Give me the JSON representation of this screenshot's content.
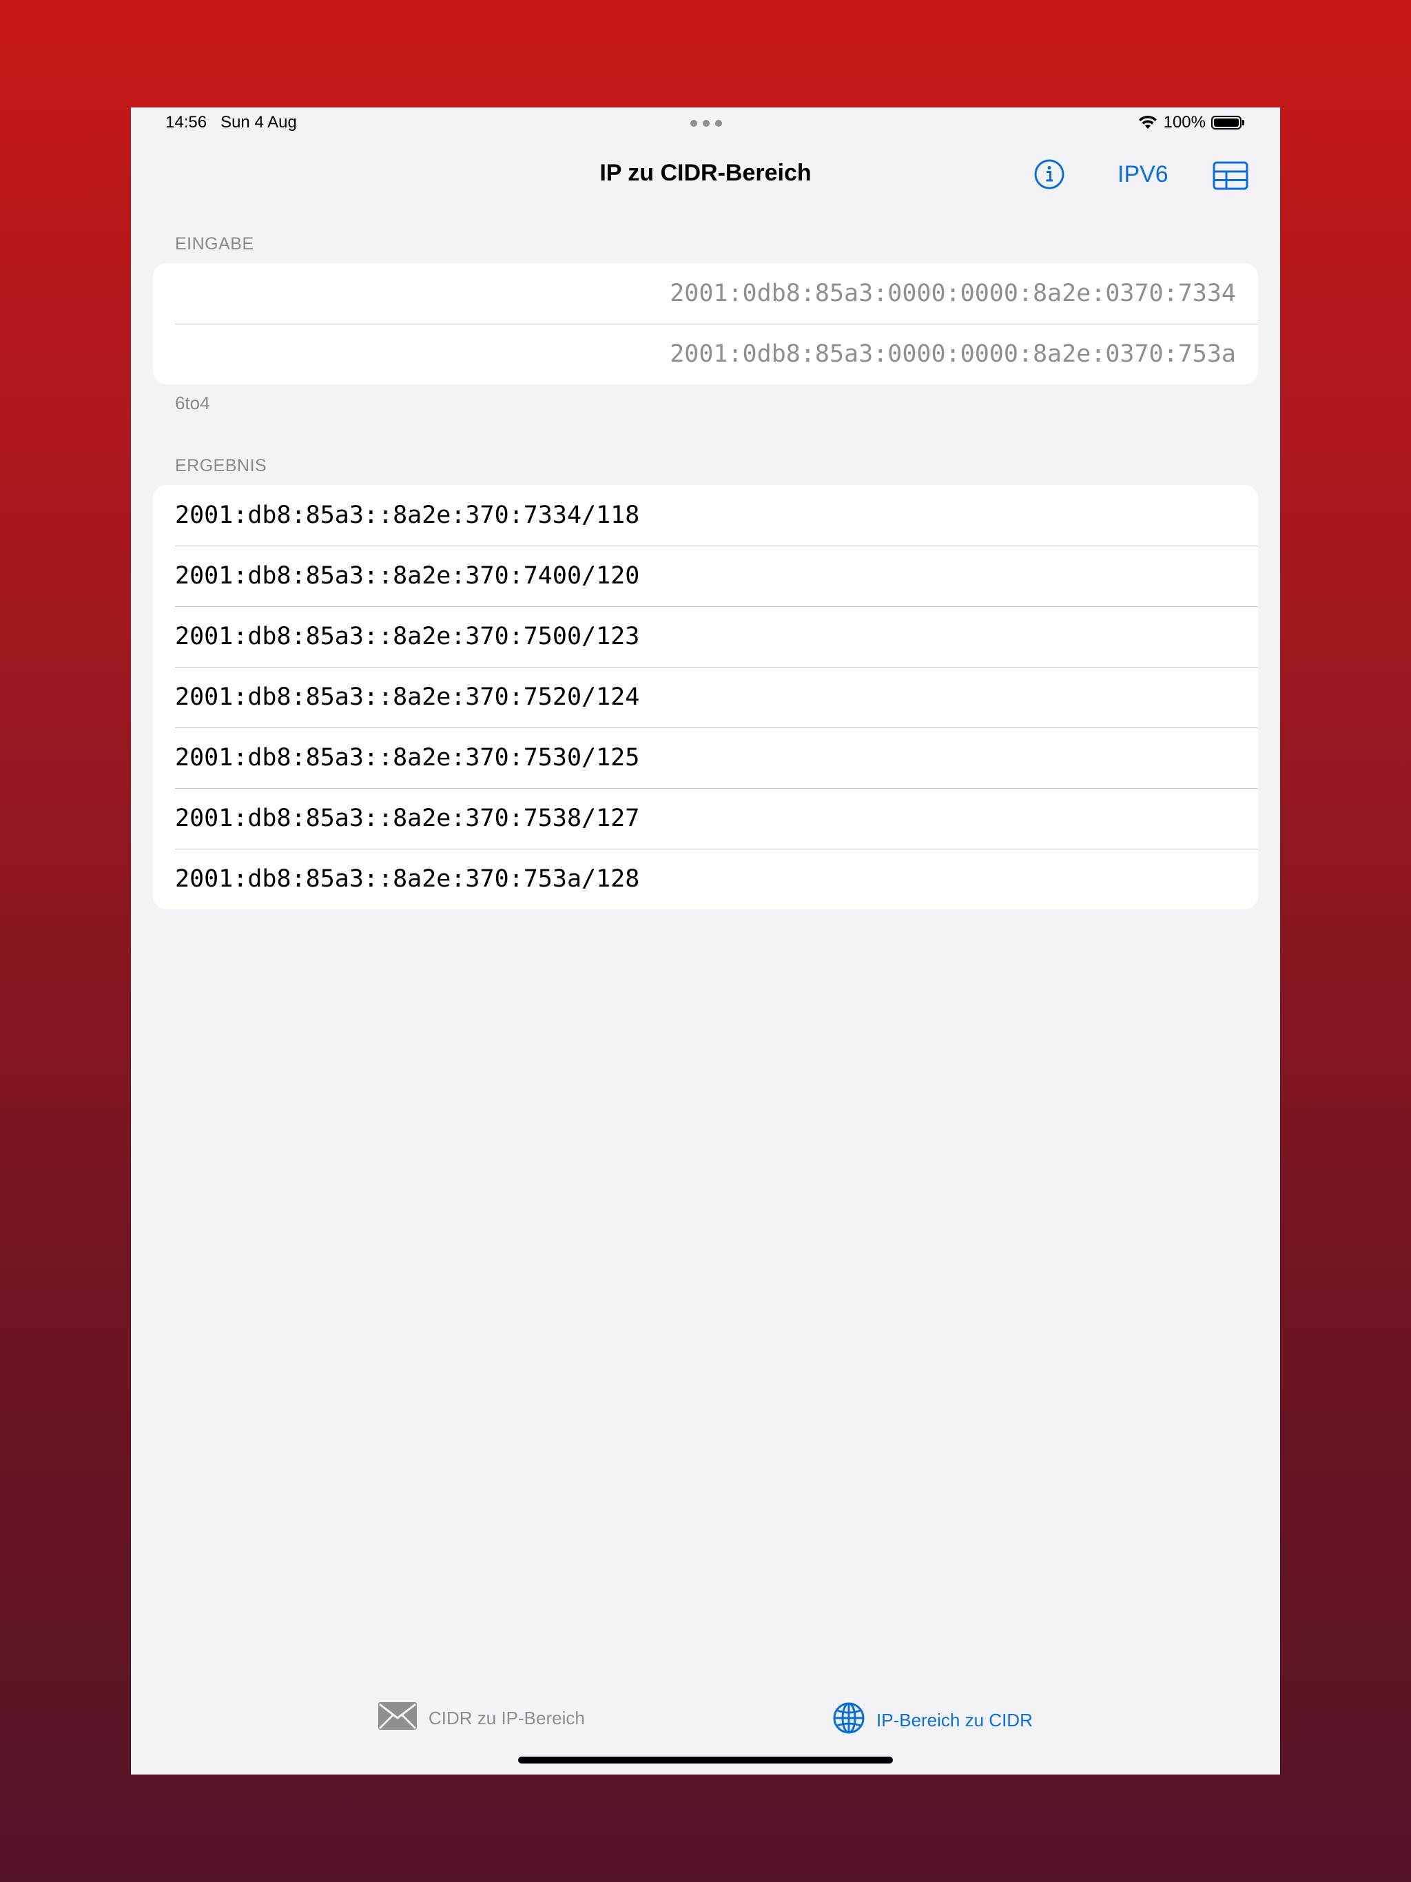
{
  "status_bar": {
    "time": "14:56",
    "date": "Sun 4 Aug",
    "battery": "100%"
  },
  "nav": {
    "title": "IP zu CIDR-Bereich",
    "ipv6_label": "IPV6",
    "accent_color": "#0a6fd6"
  },
  "input_section": {
    "header": "EINGABE",
    "start_ip": "2001:0db8:85a3:0000:0000:8a2e:0370:7334",
    "end_ip": "2001:0db8:85a3:0000:0000:8a2e:0370:753a",
    "footer": "6to4"
  },
  "result_section": {
    "header": "ERGEBNIS",
    "rows": [
      "2001:db8:85a3::8a2e:370:7334/118",
      "2001:db8:85a3::8a2e:370:7400/120",
      "2001:db8:85a3::8a2e:370:7500/123",
      "2001:db8:85a3::8a2e:370:7520/124",
      "2001:db8:85a3::8a2e:370:7530/125",
      "2001:db8:85a3::8a2e:370:7538/127",
      "2001:db8:85a3::8a2e:370:753a/128"
    ]
  },
  "tab_bar": {
    "tabs": [
      {
        "label": "CIDR zu IP-Bereich",
        "icon": "envelope-icon",
        "selected": false
      },
      {
        "label": "IP-Bereich zu CIDR",
        "icon": "globe-icon",
        "selected": true
      }
    ]
  }
}
